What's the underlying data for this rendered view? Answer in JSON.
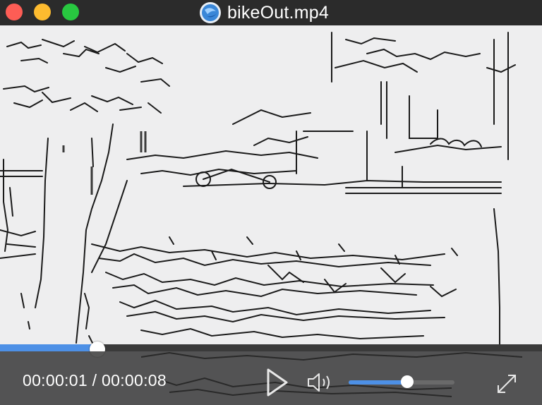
{
  "window": {
    "title": "bikeOut.mp4",
    "traffic_lights": [
      "close",
      "minimize",
      "maximize"
    ]
  },
  "player": {
    "current_time": "00:00:01",
    "separator": "/",
    "duration": "00:00:08",
    "progress_fraction": 0.18,
    "volume_fraction": 0.55,
    "accent_color": "#4d90e6",
    "controls": [
      "play-icon",
      "speaker-icon",
      "fullscreen-icon"
    ]
  }
}
